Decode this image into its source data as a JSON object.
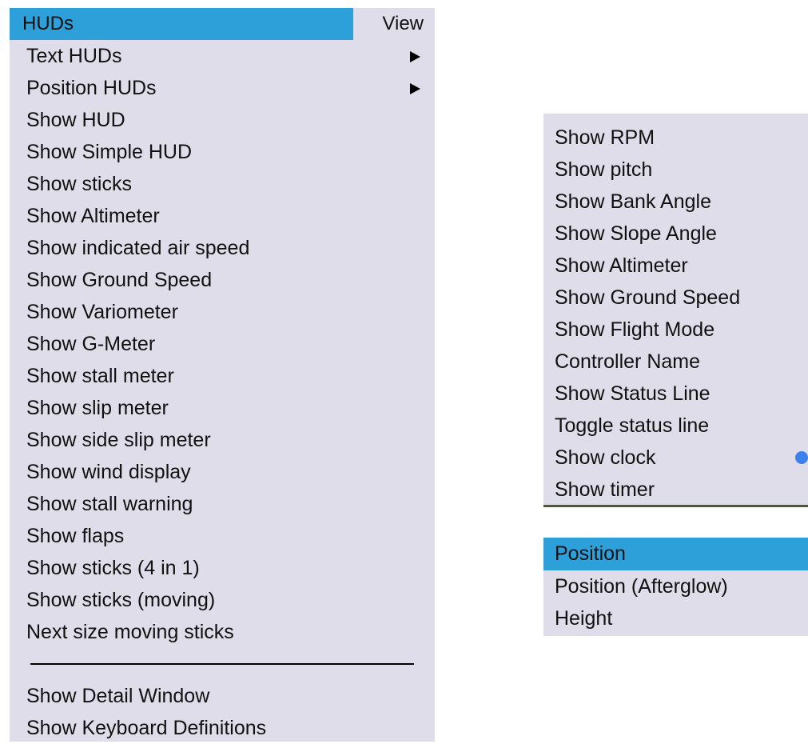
{
  "main_menu": {
    "title": "HUDs",
    "view_label": "View",
    "submenu_items": [
      {
        "label": "Text HUDs"
      },
      {
        "label": "Position HUDs"
      }
    ],
    "items": [
      {
        "label": "Show HUD"
      },
      {
        "label": "Show Simple HUD"
      },
      {
        "label": "Show sticks"
      },
      {
        "label": "Show Altimeter"
      },
      {
        "label": "Show indicated air speed"
      },
      {
        "label": "Show Ground Speed"
      },
      {
        "label": "Show Variometer"
      },
      {
        "label": "Show G-Meter"
      },
      {
        "label": "Show stall meter"
      },
      {
        "label": "Show slip meter"
      },
      {
        "label": "Show side slip meter"
      },
      {
        "label": "Show wind display"
      },
      {
        "label": "Show stall warning"
      },
      {
        "label": "Show flaps"
      },
      {
        "label": "Show sticks (4 in 1)"
      },
      {
        "label": "Show sticks (moving)"
      },
      {
        "label": "Next size moving sticks"
      }
    ],
    "bottom_items": [
      {
        "label": "Show Detail Window"
      },
      {
        "label": "Show Keyboard Definitions"
      }
    ]
  },
  "text_huds_menu": {
    "items": [
      {
        "label": "Show RPM"
      },
      {
        "label": "Show pitch"
      },
      {
        "label": "Show Bank Angle"
      },
      {
        "label": "Show Slope Angle"
      },
      {
        "label": "Show Altimeter"
      },
      {
        "label": "Show Ground Speed"
      },
      {
        "label": "Show Flight Mode"
      },
      {
        "label": "Controller Name"
      },
      {
        "label": "Show Status Line"
      },
      {
        "label": "Toggle status line"
      },
      {
        "label": "Show clock",
        "selected": true
      },
      {
        "label": "Show timer"
      }
    ]
  },
  "position_huds_menu": {
    "items": [
      {
        "label": "Position",
        "highlighted": true
      },
      {
        "label": "Position (Afterglow)"
      },
      {
        "label": "Height"
      }
    ]
  },
  "colors": {
    "menu_background": "#dedde9",
    "highlight": "#2ea0d9",
    "radio_indicator": "#3b82f0"
  }
}
